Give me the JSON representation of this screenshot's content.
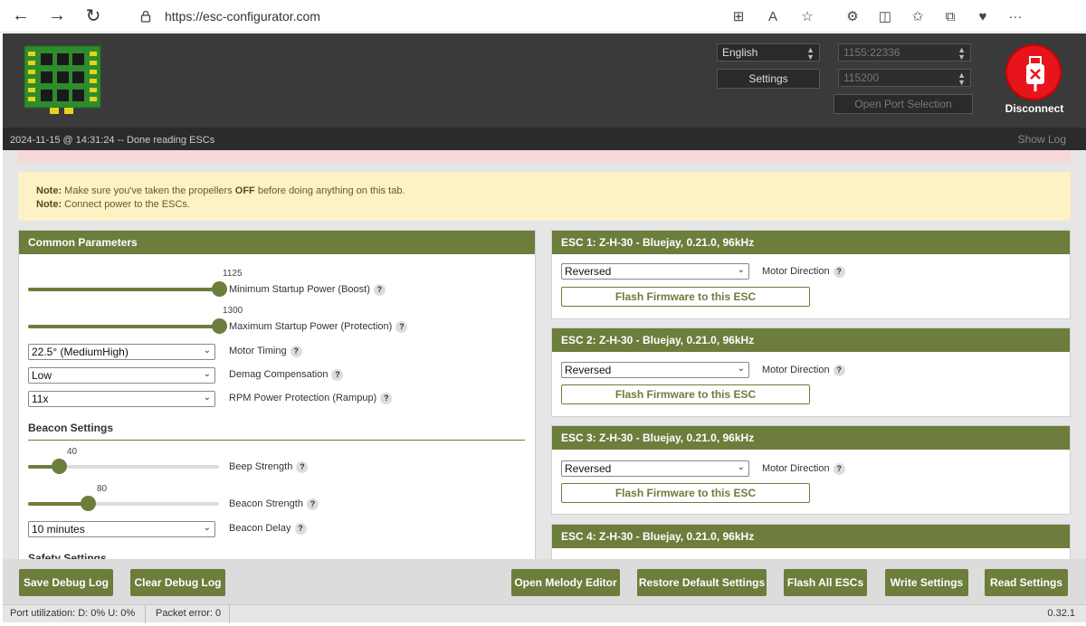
{
  "browser": {
    "url": "https://esc-configurator.com",
    "back_icon": "←",
    "forward_icon": "→",
    "refresh_icon": "↻"
  },
  "header": {
    "language": "English",
    "settings_label": "Settings",
    "port": "1155:22336",
    "baud": "115200",
    "open_port_label": "Open Port Selection",
    "disconnect_label": "Disconnect"
  },
  "log": {
    "message": "2024-11-15 @ 14:31:24 -- Done reading ESCs",
    "show_log": "Show Log"
  },
  "notes": {
    "line1_prefix": "Note:",
    "line1_a": " Make sure you've taken the propellers ",
    "line1_bold": "OFF",
    "line1_b": " before doing anything on this tab.",
    "line2_prefix": "Note:",
    "line2_text": " Connect power to the ESCs."
  },
  "common": {
    "title": "Common Parameters",
    "min_startup": {
      "value": "1125",
      "label": "Minimum Startup Power (Boost)",
      "fraction": 1.0
    },
    "max_startup": {
      "value": "1300",
      "label": "Maximum Startup Power (Protection)",
      "fraction": 1.0
    },
    "motor_timing": {
      "value": "22.5° (MediumHigh)",
      "label": "Motor Timing"
    },
    "demag": {
      "value": "Low",
      "label": "Demag Compensation"
    },
    "rpm_protection": {
      "value": "11x",
      "label": "RPM Power Protection (Rampup)"
    },
    "beacon_title": "Beacon Settings",
    "beep_strength": {
      "value": "40",
      "label": "Beep Strength",
      "fraction": 0.16
    },
    "beacon_strength": {
      "value": "80",
      "label": "Beacon Strength",
      "fraction": 0.31
    },
    "beacon_delay": {
      "value": "10 minutes",
      "label": "Beacon Delay"
    },
    "safety_title": "Safety Settings"
  },
  "escs": [
    {
      "title": "ESC 1: Z-H-30 - Bluejay, 0.21.0, 96kHz",
      "direction": "Reversed",
      "direction_label": "Motor Direction",
      "flash_label": "Flash Firmware to this ESC"
    },
    {
      "title": "ESC 2: Z-H-30 - Bluejay, 0.21.0, 96kHz",
      "direction": "Reversed",
      "direction_label": "Motor Direction",
      "flash_label": "Flash Firmware to this ESC"
    },
    {
      "title": "ESC 3: Z-H-30 - Bluejay, 0.21.0, 96kHz",
      "direction": "Reversed",
      "direction_label": "Motor Direction",
      "flash_label": "Flash Firmware to this ESC"
    },
    {
      "title": "ESC 4: Z-H-30 - Bluejay, 0.21.0, 96kHz"
    }
  ],
  "toolbar": {
    "save_debug": "Save Debug Log",
    "clear_debug": "Clear Debug Log",
    "melody": "Open Melody Editor",
    "restore": "Restore Default Settings",
    "flash_all": "Flash All ESCs",
    "write": "Write Settings",
    "read": "Read Settings"
  },
  "status": {
    "port_util": "Port utilization: D: 0% U: 0%",
    "packet_error": "Packet error: 0",
    "version": "0.32.1"
  },
  "colors": {
    "accent": "#6c7d3c",
    "header_bg": "#3a3a3a",
    "disconnect": "#e8141c",
    "note_bg": "#fdf1c6"
  }
}
